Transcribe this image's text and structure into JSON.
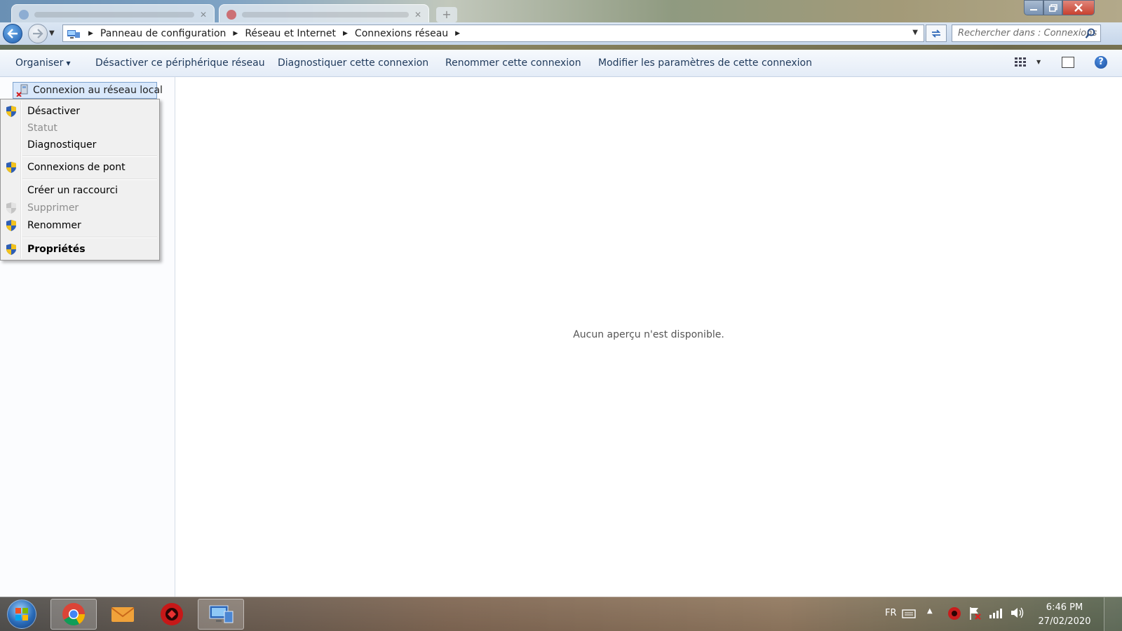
{
  "window": {
    "controls": {
      "minimize": "minimize",
      "maximize": "maximize",
      "close": "close"
    }
  },
  "address_bar": {
    "breadcrumbs": [
      {
        "label": "Panneau de configuration"
      },
      {
        "label": "Réseau et Internet"
      },
      {
        "label": "Connexions réseau"
      }
    ],
    "search_placeholder": "Rechercher dans : Connexions ..."
  },
  "command_bar": {
    "organize": "Organiser",
    "disable_device": "Désactiver ce périphérique réseau",
    "diagnose": "Diagnostiquer cette connexion",
    "rename": "Renommer cette connexion",
    "change_settings": "Modifier les paramètres de cette connexion"
  },
  "selected_item": {
    "label": "Connexion au réseau local"
  },
  "context_menu": {
    "items": [
      {
        "label": "Désactiver",
        "shield": true,
        "disabled": false,
        "bold": false
      },
      {
        "label": "Statut",
        "shield": false,
        "disabled": true,
        "bold": false
      },
      {
        "label": "Diagnostiquer",
        "shield": false,
        "disabled": false,
        "bold": false
      },
      {
        "label": "Connexions de pont",
        "shield": true,
        "disabled": false,
        "bold": false
      },
      {
        "label": "Créer un raccourci",
        "shield": false,
        "disabled": false,
        "bold": false
      },
      {
        "label": "Supprimer",
        "shield": true,
        "disabled": true,
        "bold": false
      },
      {
        "label": "Renommer",
        "shield": true,
        "disabled": false,
        "bold": false
      },
      {
        "label": "Propriétés",
        "shield": true,
        "disabled": false,
        "bold": true
      }
    ]
  },
  "preview": {
    "message": "Aucun aperçu n'est disponible."
  },
  "taskbar": {
    "apps": [
      {
        "name": "chrome",
        "active": true
      },
      {
        "name": "mail",
        "active": false
      },
      {
        "name": "security-app",
        "active": false
      },
      {
        "name": "network-connections",
        "active": true
      }
    ],
    "language": "FR",
    "time": "6:46 PM",
    "date": "27/02/2020"
  },
  "colors": {
    "accent": "#1e5cae",
    "menu_background": "#f0f0f0",
    "selection": "#d9e8fb",
    "disabled_text": "#8d8d8d"
  }
}
